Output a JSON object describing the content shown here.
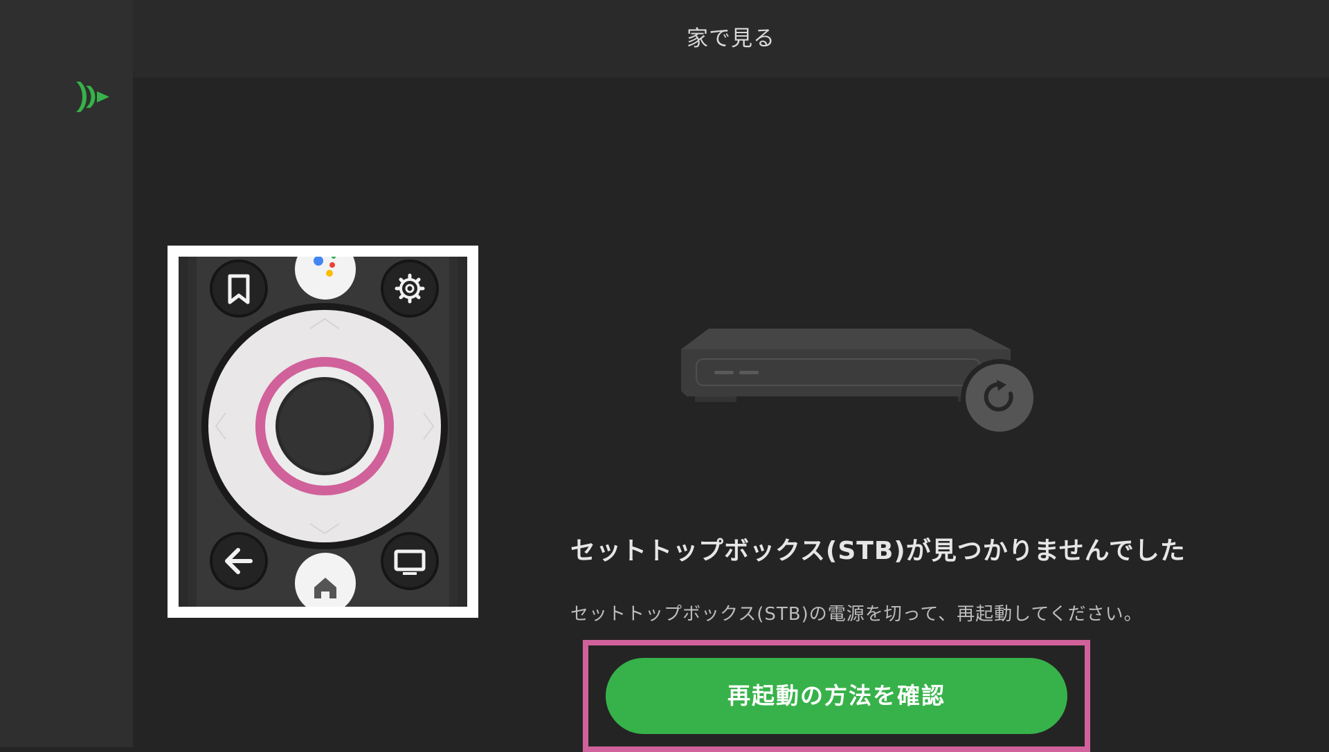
{
  "header": {
    "title": "家で見る"
  },
  "sidebar": {
    "logo_icon": "play-logo-icon"
  },
  "remote": {
    "icons": [
      "bookmark-icon",
      "assistant-icon",
      "gear-icon",
      "back-arrow-icon",
      "home-icon",
      "tv-icon"
    ],
    "highlight_color": "#d0619a"
  },
  "stb": {
    "icons": [
      "set-top-box-icon",
      "restart-icon"
    ]
  },
  "message": {
    "heading": "セットトップボックス(STB)が見つかりませんでした",
    "body": "セットトップボックス(STB)の電源を切って、再起動してください。"
  },
  "actions": {
    "confirm_restart_label": "再起動の方法を確認"
  },
  "colors": {
    "accent": "#37b24a",
    "focus": "#d0619a",
    "background": "#242424"
  }
}
